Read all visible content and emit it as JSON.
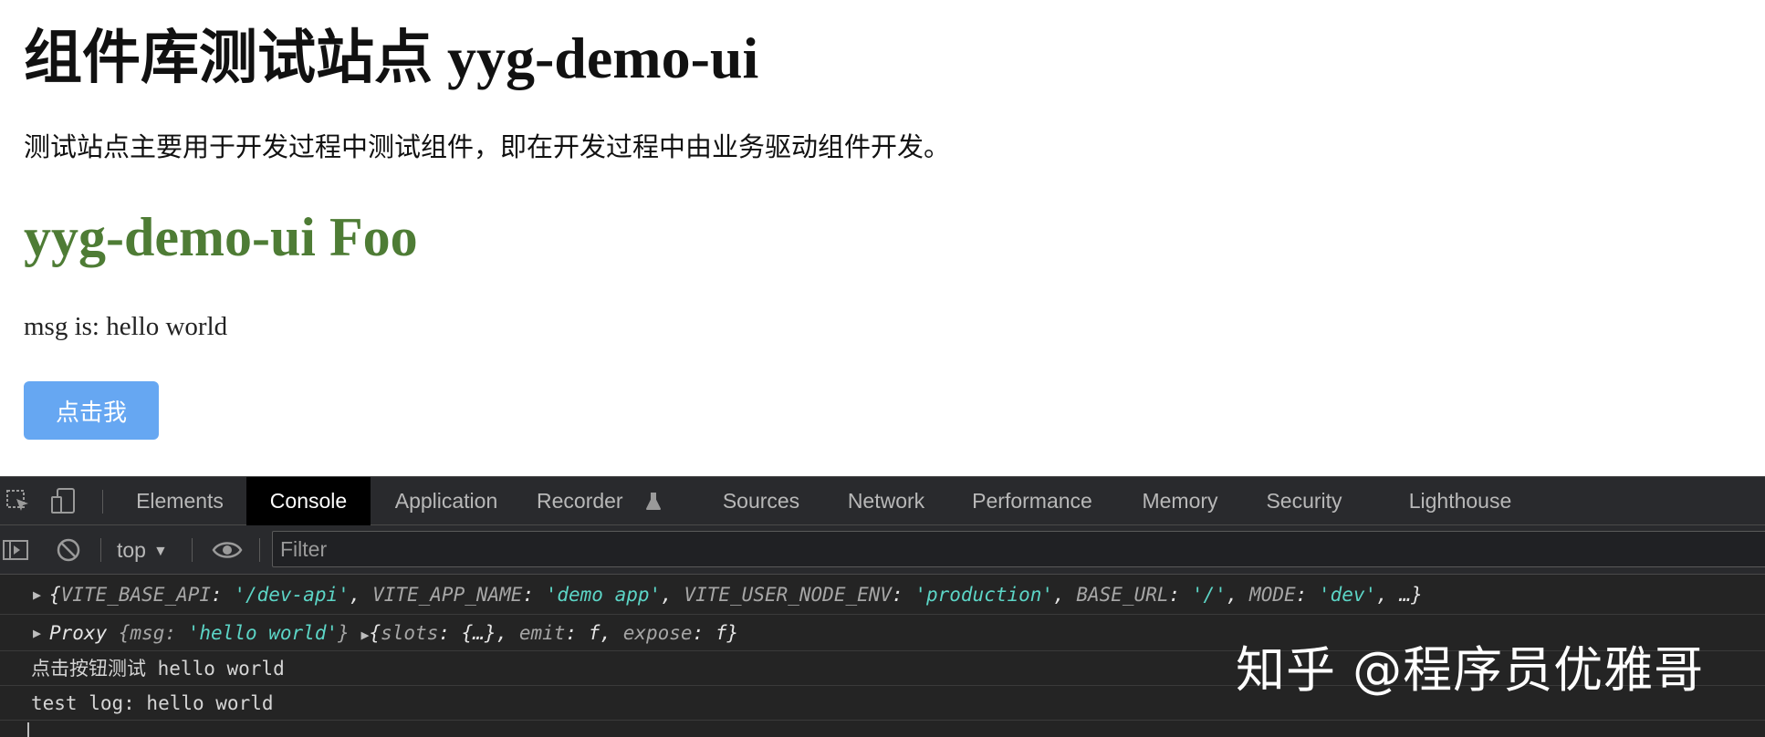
{
  "page": {
    "title": "组件库测试站点 yyg-demo-ui",
    "description": "测试站点主要用于开发过程中测试组件，即在开发过程中由业务驱动组件开发。",
    "component_title": "yyg-demo-ui Foo",
    "msg_line": "msg is: hello world",
    "button_label": "点击我"
  },
  "devtools": {
    "tabs": [
      "Elements",
      "Console",
      "Application",
      "Recorder",
      "Sources",
      "Network",
      "Performance",
      "Memory",
      "Security",
      "Lighthouse"
    ],
    "active_tab": "Console",
    "toolbar": {
      "context": "top",
      "filter_placeholder": "Filter"
    },
    "console": {
      "line1": {
        "open": "{",
        "k1": "VITE_BASE_API",
        "v1": "'/dev-api'",
        "k2": "VITE_APP_NAME",
        "v2": "'demo app'",
        "k3": "VITE_USER_NODE_ENV",
        "v3": "'production'",
        "k4": "BASE_URL",
        "v4": "'/'",
        "k5": "MODE",
        "v5": "'dev'",
        "close": "…}"
      },
      "line2": {
        "proxy": "Proxy",
        "k1": "msg",
        "v1": "'hello world'",
        "k2": "slots",
        "v2": "{…}",
        "k3": "emit",
        "v3": "f",
        "k4": "expose",
        "v4": "f"
      },
      "line3": "点击按钮测试 hello world",
      "line4": "test log:  hello world"
    }
  },
  "watermark": "知乎 @程序员优雅哥",
  "colors": {
    "component_title": "#4e7c35",
    "button_bg": "#66a7f2",
    "devtools_bg": "#242424",
    "string_value": "#5cd5c6"
  }
}
